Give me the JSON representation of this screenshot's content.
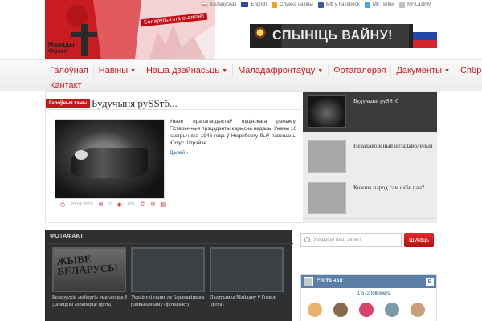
{
  "header": {
    "logo_text": "Малады Фронт",
    "logo_ribbon": "Беларусь-гэта сьвятое!",
    "top_links": [
      {
        "label": "Беларуская",
        "icon": "flag-by-icon"
      },
      {
        "label": "English",
        "icon": "flag-en-icon"
      },
      {
        "label": "Служка навіны",
        "icon": "rss-icon",
        "color": "#f2a21b"
      },
      {
        "label": "МФ у Facebook",
        "icon": "facebook-icon",
        "color": "#3b5998"
      },
      {
        "label": "MF.Twitter",
        "icon": "twitter-icon",
        "color": "#4aa8e0"
      },
      {
        "label": "MF.LastFM",
        "icon": "lastfm-icon",
        "color": "#c0c0c0"
      }
    ],
    "banner_text": "СПЫНІЦЬ ВАЙНУ!"
  },
  "nav": {
    "row1": [
      {
        "label": "Галоўная",
        "dropdown": false
      },
      {
        "label": "Навіны",
        "dropdown": true
      },
      {
        "label": "Наша дзейнасьць",
        "dropdown": true
      },
      {
        "label": "Маладафронтаўцу",
        "dropdown": true
      },
      {
        "label": "Фотагалерэя",
        "dropdown": false
      },
      {
        "label": "Дакументы",
        "dropdown": true
      },
      {
        "label": "Сябры",
        "dropdown": false
      }
    ],
    "row2": [
      {
        "label": "Кантакт",
        "dropdown": false
      }
    ]
  },
  "featured": {
    "rubric": "Галоўныя тэмы",
    "title": "Будучыня руSSтб...",
    "text": "Увазе прапагандыстаў пуцінскага рэжыму. Гістарычныя прэцэдэнты карысна ведаць. Уначы 16 кастрычніка 1946 года ў Нюрнбергу быў павешаны Юліус Штрэйхе.",
    "more_label": "Далей ›",
    "meta": {
      "date": "23.04.2015",
      "comments": "0",
      "views": "635"
    }
  },
  "side_list": [
    {
      "title": "Будучыня руSSтб",
      "active": true
    },
    {
      "title": "Незадаволеныя незадаволеныя",
      "active": false
    },
    {
      "title": "Кожны народ сам сабе пан?",
      "active": false
    }
  ],
  "fotafakt": {
    "heading": "ФОТАФАКТ",
    "graffiti": "ЖЫВЕ БЕЛАРУСЬ!",
    "items": [
      "Беларускія «кіборгі» змагаюцца ў Данецкім аэрапорце (фота)",
      "Украінскі сьцяг ля Баранавіцкага райвыканкаму (фотафакт)",
      "Падтрымка Майдану ў Гомелі (фота)"
    ]
  },
  "search": {
    "placeholder": "Увядзіце ваш запыт",
    "button_label": "Шукаць"
  },
  "vk": {
    "group_name": "СВІТАНАК",
    "followers": "1,572 followers",
    "logo": "B",
    "face_colors": [
      "#e8b36a",
      "#8a6a4f",
      "#d7436a",
      "#7a9aa8",
      "#c9a07a"
    ]
  }
}
